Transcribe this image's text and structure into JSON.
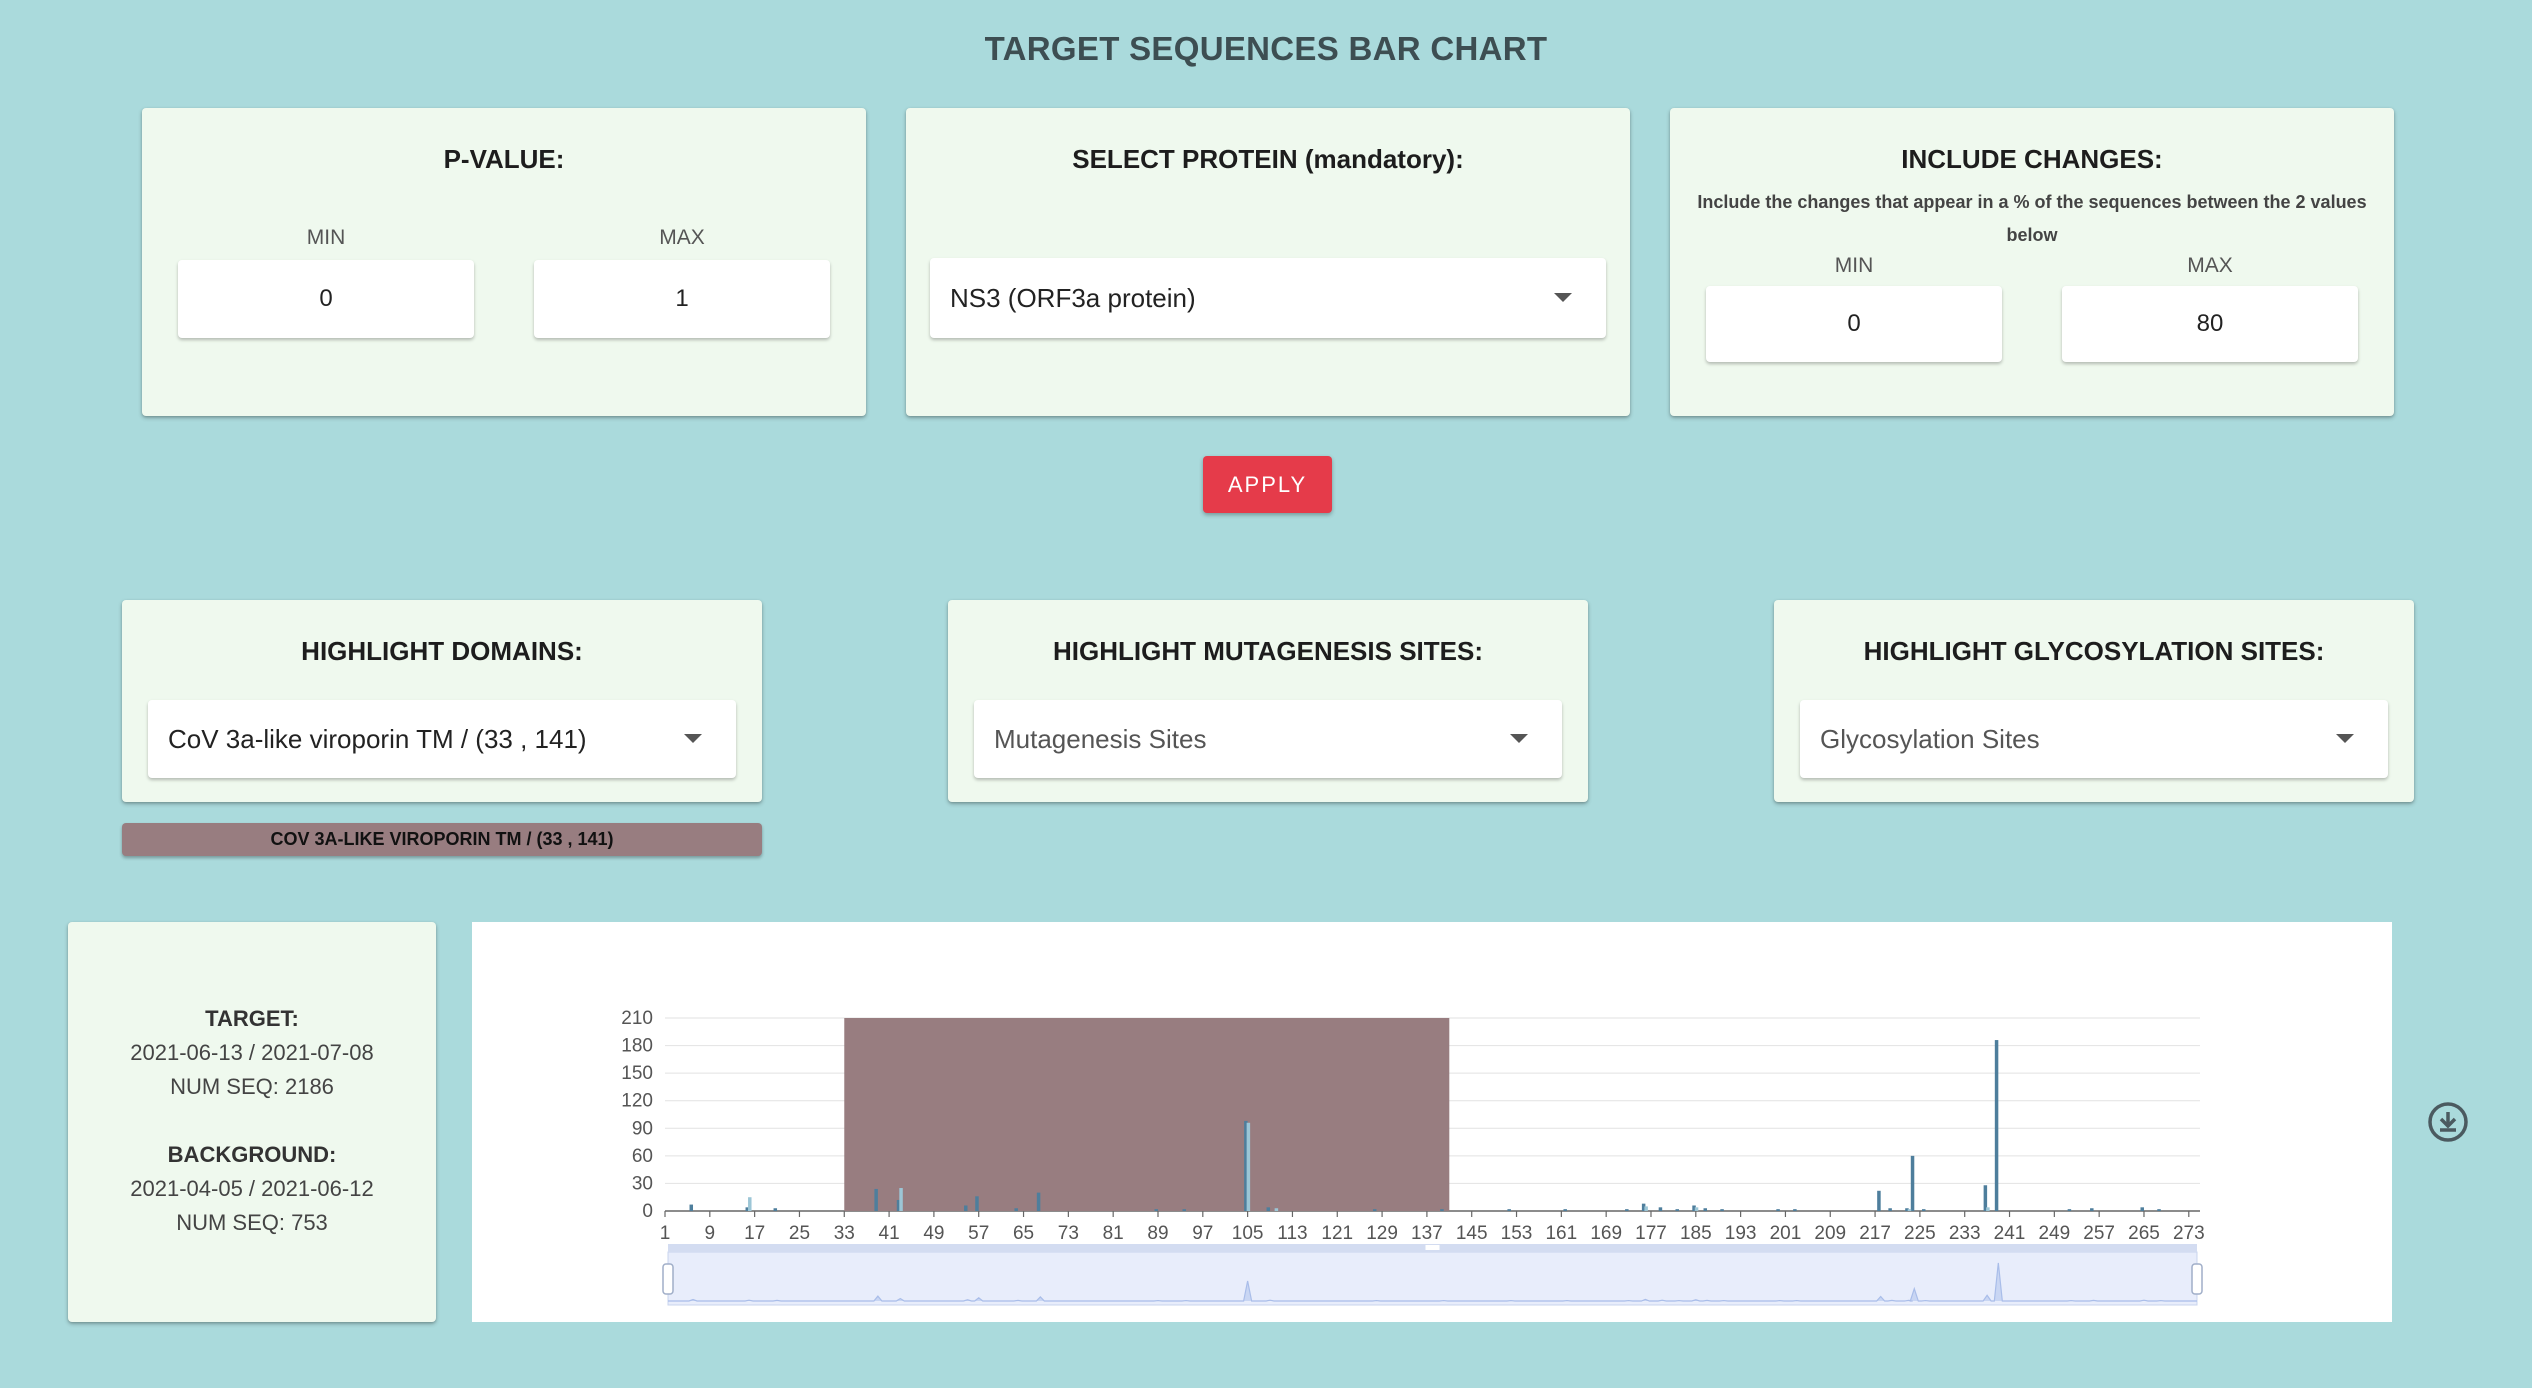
{
  "page": {
    "title": "TARGET SEQUENCES BAR CHART"
  },
  "pvalue": {
    "title": "P-VALUE:",
    "min_label": "MIN",
    "max_label": "MAX",
    "min_value": "0",
    "max_value": "1"
  },
  "protein": {
    "title": "SELECT PROTEIN (mandatory):",
    "selected": "NS3 (ORF3a protein)"
  },
  "changes": {
    "title": "INCLUDE CHANGES:",
    "hint": "Include the changes that appear in a % of the sequences between the 2 values below",
    "min_label": "MIN",
    "max_label": "MAX",
    "min_value": "0",
    "max_value": "80"
  },
  "apply_label": "APPLY",
  "domains": {
    "title": "HIGHLIGHT DOMAINS:",
    "selected": "CoV 3a-like viroporin TM / (33 , 141)",
    "chip": "COV 3A-LIKE VIROPORIN TM / (33 , 141)"
  },
  "mutagenesis": {
    "title": "HIGHLIGHT MUTAGENESIS SITES:",
    "placeholder": "Mutagenesis Sites"
  },
  "glycosylation": {
    "title": "HIGHLIGHT GLYCOSYLATION SITES:",
    "placeholder": "Glycosylation Sites"
  },
  "info": {
    "target_label": "TARGET:",
    "target_dates": "2021-06-13 / 2021-07-08",
    "target_numseq": "NUM SEQ: 2186",
    "background_label": "BACKGROUND:",
    "background_dates": "2021-04-05 / 2021-06-12",
    "background_numseq": "NUM SEQ: 753"
  },
  "colors": {
    "target_bar": "#4e7e9c",
    "background_bar": "#9cc6d6",
    "domain_highlight": "#987d80",
    "apply": "#e53b4a"
  },
  "icons": {
    "download": "download-icon",
    "caret": "chevron-down-icon"
  },
  "chart_data": {
    "type": "bar",
    "xlim": [
      1,
      275
    ],
    "ylim": [
      0,
      210
    ],
    "yticks": [
      0,
      30,
      60,
      90,
      120,
      150,
      180,
      210
    ],
    "xticks": [
      1,
      9,
      17,
      25,
      33,
      41,
      49,
      57,
      65,
      73,
      81,
      89,
      97,
      105,
      113,
      121,
      129,
      137,
      145,
      153,
      161,
      169,
      177,
      185,
      193,
      201,
      209,
      217,
      225,
      233,
      241,
      249,
      257,
      265,
      273
    ],
    "grid": true,
    "highlight": {
      "label": "CoV 3a-like viroporin TM / (33 , 141)",
      "start": 33,
      "end": 141
    },
    "series": [
      {
        "points": [
          [
            6,
            7
          ],
          [
            16,
            4
          ],
          [
            21,
            3
          ],
          [
            39,
            24
          ],
          [
            43,
            12
          ],
          [
            55,
            6
          ],
          [
            57,
            16
          ],
          [
            64,
            3
          ],
          [
            68,
            20
          ],
          [
            89,
            2
          ],
          [
            94,
            2
          ],
          [
            105,
            98
          ],
          [
            109,
            4
          ],
          [
            128,
            2
          ],
          [
            140,
            2
          ],
          [
            152,
            2
          ],
          [
            162,
            2
          ],
          [
            173,
            2
          ],
          [
            176,
            8
          ],
          [
            179,
            4
          ],
          [
            182,
            2
          ],
          [
            185,
            6
          ],
          [
            187,
            3
          ],
          [
            190,
            2
          ],
          [
            200,
            2
          ],
          [
            203,
            2
          ],
          [
            218,
            22
          ],
          [
            220,
            3
          ],
          [
            223,
            3
          ],
          [
            224,
            60
          ],
          [
            226,
            2
          ],
          [
            237,
            28
          ],
          [
            239,
            186
          ],
          [
            252,
            2
          ],
          [
            256,
            3
          ],
          [
            265,
            4
          ],
          [
            268,
            2
          ]
        ]
      },
      {
        "points": [
          [
            16,
            15
          ],
          [
            43,
            25
          ],
          [
            105,
            96
          ],
          [
            110,
            3
          ],
          [
            176,
            5
          ],
          [
            185,
            4
          ],
          [
            223,
            2
          ],
          [
            237,
            4
          ]
        ]
      }
    ]
  }
}
